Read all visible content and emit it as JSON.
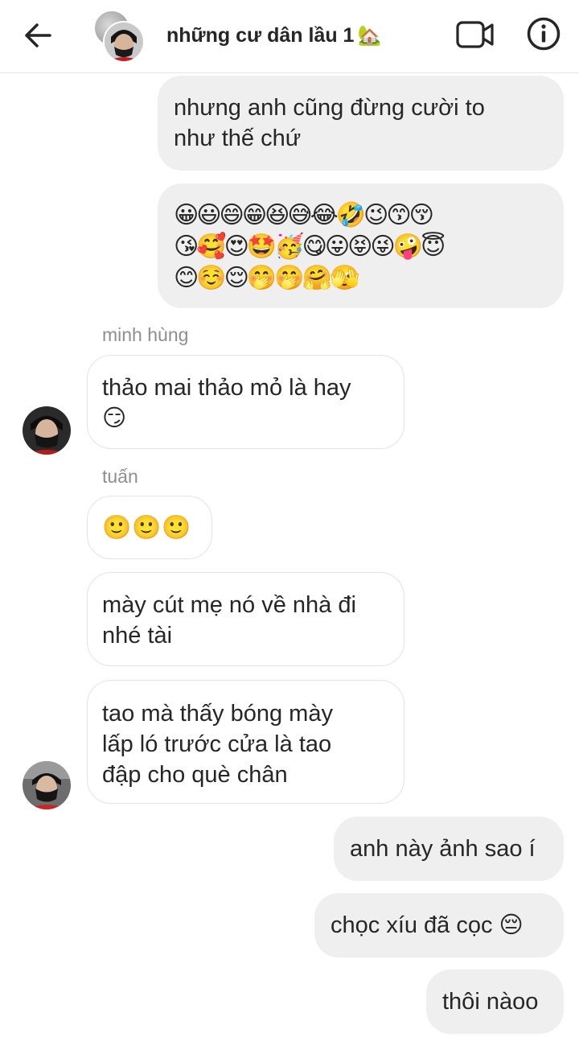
{
  "header": {
    "title": "những cư dân lầu 1",
    "title_emoji": "🏡"
  },
  "messages": [
    {
      "id": "m1",
      "direction": "out",
      "text": "nhưng anh cũng đừng cười to\nnhư thế chứ"
    },
    {
      "id": "m2",
      "direction": "out",
      "text": "😀😃😄😁😆😅😂🤣😉😙😚\n😘🥰😍🤩🥳😋😛😝😜🤪😇\n😊☺️😌🤭🤭🤗🫣"
    },
    {
      "id": "m3",
      "direction": "in",
      "sender": "minh hùng",
      "text": "thảo mai thảo mỏ là hay\n😏"
    },
    {
      "id": "m4",
      "direction": "in",
      "sender": "tuấn",
      "text": "🙂🙂🙂"
    },
    {
      "id": "m5",
      "direction": "in",
      "text": "mày cút mẹ nó về nhà đi\nnhé tài"
    },
    {
      "id": "m6",
      "direction": "in",
      "text": "tao mà thấy bóng mày\nlấp ló trước cửa là tao\nđập cho què chân"
    },
    {
      "id": "m7",
      "direction": "out",
      "text": "anh này ảnh sao í"
    },
    {
      "id": "m8",
      "direction": "out",
      "text": "chọc xíu đã cọc 😔"
    },
    {
      "id": "m9",
      "direction": "out",
      "text": "thôi nàoo"
    }
  ]
}
